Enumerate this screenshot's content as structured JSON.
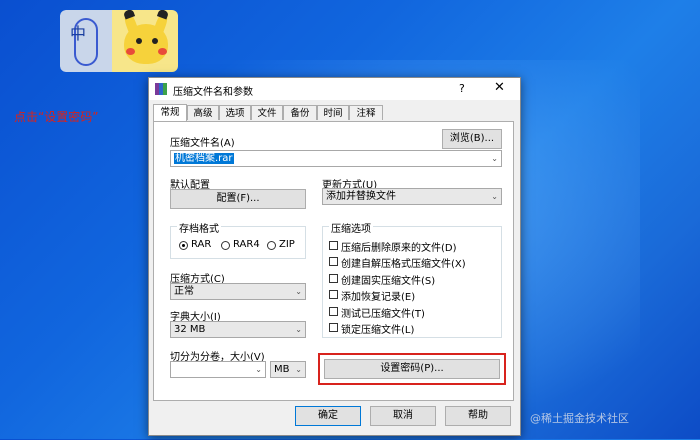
{
  "annotation": "点击“设置密码”",
  "widget": {
    "ime_char": "中"
  },
  "dialog": {
    "title": "压缩文件名和参数",
    "help": "?",
    "close": "✕",
    "tabs": [
      "常规",
      "高级",
      "选项",
      "文件",
      "备份",
      "时间",
      "注释"
    ],
    "archive_name_label": "压缩文件名(A)",
    "browse_label": "浏览(B)...",
    "archive_name_value": "机密档案.rar",
    "default_config_label": "默认配置",
    "config_button": "配置(F)...",
    "update_mode_label": "更新方式(U)",
    "update_mode_value": "添加并替换文件",
    "format_group_title": "存档格式",
    "formats": [
      "RAR",
      "RAR4",
      "ZIP"
    ],
    "selected_format": "RAR",
    "options_group_title": "压缩选项",
    "options": [
      "压缩后删除原来的文件(D)",
      "创建自解压格式压缩文件(X)",
      "创建固实压缩文件(S)",
      "添加恢复记录(E)",
      "测试已压缩文件(T)",
      "锁定压缩文件(L)"
    ],
    "method_label": "压缩方式(C)",
    "method_value": "正常",
    "dict_label": "字典大小(I)",
    "dict_value": "32 MB",
    "split_label": "切分为分卷，大小(V)",
    "split_value": "",
    "split_unit": "MB",
    "set_password": "设置密码(P)...",
    "ok": "确定",
    "cancel": "取消",
    "help_button": "帮助"
  },
  "watermark": "@稀土掘金技术社区",
  "colors": {
    "highlight": "#d8231d",
    "selection": "#0078d7"
  }
}
